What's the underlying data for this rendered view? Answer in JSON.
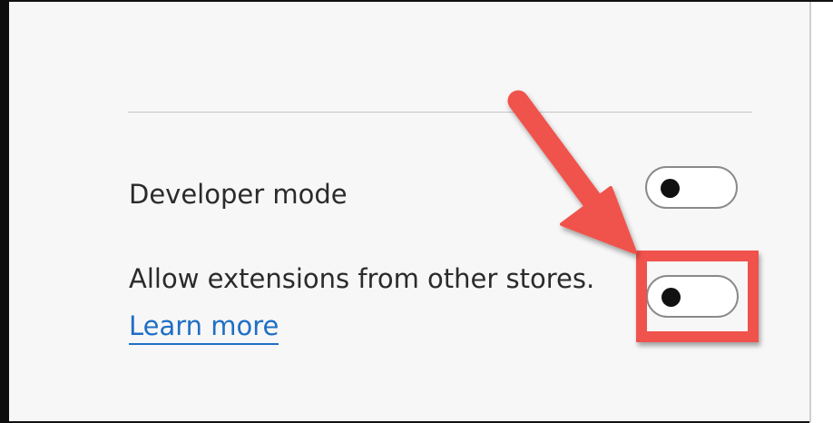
{
  "settings": {
    "developer_mode_label": "Developer mode",
    "allow_extensions_label": "Allow extensions from other stores.",
    "learn_more_link": "Learn more"
  },
  "toggles": {
    "developer_mode": "off",
    "allow_extensions": "off"
  },
  "annotation": {
    "arrow_color": "#f0524c",
    "highlight_color": "#f0524c",
    "link_color": "#1f6fc5"
  }
}
